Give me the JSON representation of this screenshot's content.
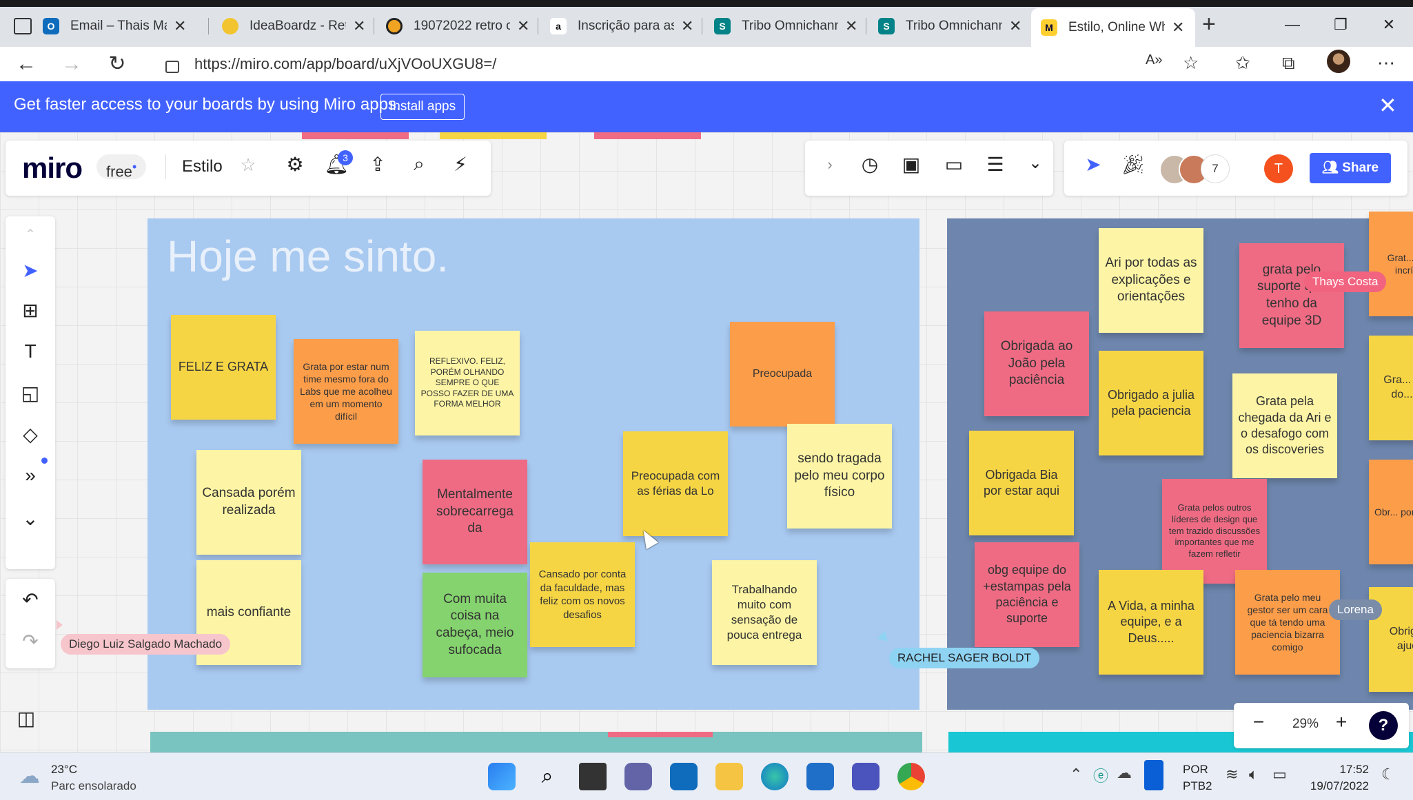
{
  "browser": {
    "tabs": [
      {
        "title": "Email – Thais Ma",
        "fav": "outlook",
        "color": "#0f6cbd"
      },
      {
        "title": "IdeaBoardz - Ret",
        "fav": "bulb",
        "color": "#f2c530"
      },
      {
        "title": "19072022 retro c",
        "fav": "circle",
        "color": "#222222"
      },
      {
        "title": "Inscrição para as",
        "fav": "amazon",
        "color": "#ffffff"
      },
      {
        "title": "Tribo Omnichann",
        "fav": "sharepoint",
        "color": "#038387"
      },
      {
        "title": "Tribo Omnichann",
        "fav": "sharepoint",
        "color": "#038387"
      },
      {
        "title": "Estilo, Online Wh",
        "fav": "miro",
        "color": "#ffd02f"
      }
    ],
    "url": "https://miro.com/app/board/uXjVOoUXGU8=/"
  },
  "banner": {
    "text": "Get faster access to your boards by using Miro apps.",
    "button": "Install apps",
    "bg": "#4262ff"
  },
  "miro": {
    "logo": "miro",
    "plan": "free",
    "board_name": "Estilo",
    "notification_count": "3",
    "collaborators_count": "7",
    "user_initial": "T",
    "share_label": "Share",
    "zoom": "29%",
    "help": "?"
  },
  "frame_left": {
    "title": "Hoje me sinto.",
    "bg": "#a8c9f0",
    "notes": [
      {
        "text": "FELIZ E GRATA",
        "color": "y"
      },
      {
        "text": "Grata por estar num time mesmo fora do Labs que me acolheu em um momento difícil",
        "color": "or"
      },
      {
        "text": "REFLEXIVO. FELIZ, PORÉM OLHANDO SEMPRE O QUE POSSO FAZER DE UMA FORMA MELHOR",
        "color": "ly"
      },
      {
        "text": "Preocupada",
        "color": "or"
      },
      {
        "text": "Cansada porém realizada",
        "color": "ly"
      },
      {
        "text": "Mentalmente sobrecarrega da",
        "color": "pk"
      },
      {
        "text": "Preocupada com as férias da Lo",
        "color": "y"
      },
      {
        "text": "sendo tragada pelo meu corpo físico",
        "color": "ly"
      },
      {
        "text": "Cansado por conta da faculdade, mas feliz com os novos desafios",
        "color": "y"
      },
      {
        "text": "mais confiante",
        "color": "ly"
      },
      {
        "text": "Com muita coisa na cabeça, meio sufocada",
        "color": "gr"
      },
      {
        "text": "Trabalhando muito com sensação de pouca entrega",
        "color": "ly"
      }
    ]
  },
  "frame_right": {
    "bg": "#6e86ad",
    "notes": [
      {
        "text": "Ari por todas as explicações e orientações",
        "color": "ly"
      },
      {
        "text": "grata pelo suporte que tenho da equipe 3D",
        "color": "pk"
      },
      {
        "text": "Obrigada ao João pela paciência",
        "color": "pk"
      },
      {
        "text": "Obrigado a julia pela paciencia",
        "color": "y"
      },
      {
        "text": "Grata pela chegada da Ari e o desafogo com os discoveries",
        "color": "ly"
      },
      {
        "text": "Obrigada Bia por estar aqui",
        "color": "y"
      },
      {
        "text": "Grata pelos outros líderes de design que tem trazido discussões importantes que me fazem refletir",
        "color": "pk"
      },
      {
        "text": "obg equipe do +estampas pela paciência e suporte",
        "color": "pk"
      },
      {
        "text": "A Vida, a minha equipe, e a Deus.....",
        "color": "y"
      },
      {
        "text": "Grata pelo meu gestor ser um cara que tá tendo uma paciencia bizarra comigo",
        "color": "or"
      },
      {
        "text": "Grat... últimas... incrí... des...",
        "color": "or"
      },
      {
        "text": "Gra... dispo... e do... coleg...",
        "color": "y"
      },
      {
        "text": "Obr... por... féria...",
        "color": "or"
      },
      {
        "text": "Obrig... Lor... ajud... d...",
        "color": "y"
      }
    ]
  },
  "cursors": [
    {
      "name": "Diego Luiz Salgado Machado",
      "color": "#f7c6cc"
    },
    {
      "name": "RACHEL SAGER BOLDT",
      "color": "#8fd3f3"
    },
    {
      "name": "Thays Costa",
      "color": "#f1637f"
    },
    {
      "name": "Lorena",
      "color": "#7a8ca8"
    }
  ],
  "taskbar": {
    "temp": "23°C",
    "weather": "Parc ensolarado",
    "lang1": "POR",
    "lang2": "PTB2",
    "time": "17:52",
    "date": "19/07/2022"
  }
}
